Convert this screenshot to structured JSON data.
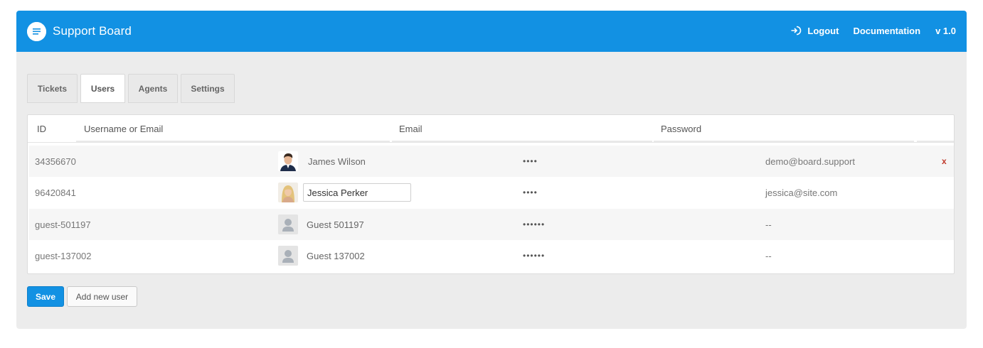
{
  "app": {
    "title": "Support Board"
  },
  "header": {
    "logout_label": "Logout",
    "documentation_label": "Documentation",
    "version": "v 1.0"
  },
  "tabs": [
    {
      "label": "Tickets",
      "active": false
    },
    {
      "label": "Users",
      "active": true
    },
    {
      "label": "Agents",
      "active": false
    },
    {
      "label": "Settings",
      "active": false
    }
  ],
  "table": {
    "columns": [
      "ID",
      "Username or Email",
      "Email",
      "Password"
    ],
    "rows": [
      {
        "id": "34356670",
        "name": "James Wilson",
        "password": "••••",
        "email": "demo@board.support",
        "avatar": "male-avatar",
        "delete": "x"
      },
      {
        "id": "96420841",
        "name": "Jessica Perker",
        "password": "••••",
        "email": "jessica@site.com",
        "avatar": "female-avatar",
        "editing": true
      },
      {
        "id": "guest-501197",
        "name": "Guest 501197",
        "password": "••••••",
        "email": "--",
        "avatar": "guest-avatar"
      },
      {
        "id": "guest-137002",
        "name": "Guest 137002",
        "password": "••••••",
        "email": "--",
        "avatar": "guest-avatar"
      }
    ]
  },
  "buttons": {
    "save": "Save",
    "add_new_user": "Add new user"
  },
  "colors": {
    "primary": "#1291e3",
    "panel_bg": "#ececec",
    "delete": "#c0392b"
  }
}
